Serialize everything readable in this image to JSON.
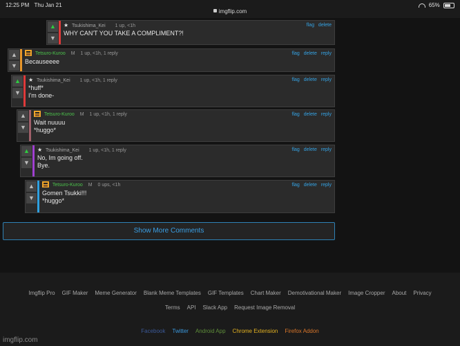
{
  "status_bar": {
    "time": "12:25 PM",
    "date": "Thu Jan 21",
    "url": "imgflip.com",
    "battery": "65%",
    "battery_level": 0.65
  },
  "comments": [
    {
      "user": "Tsukishima_Kei",
      "mod": "",
      "stats": "1 up, <1h",
      "actions": [
        "flag",
        "delete"
      ],
      "lines": "WHY CAN'T YOU TAKE A COMPLIMENT?!",
      "accent": "#e03a3a",
      "upvoted": true,
      "avatar": "star-icon",
      "name_color": "gray"
    },
    {
      "user": "Tetsuro-Kuroo",
      "mod": "M",
      "stats": "1 up, <1h, 1 reply",
      "actions": [
        "flag",
        "delete",
        "reply"
      ],
      "lines": "Becauseeee",
      "accent": "#e8962a",
      "upvoted": false,
      "avatar": "avatar-icon",
      "name_color": "green"
    },
    {
      "user": "Tsukishima_Kei",
      "mod": "",
      "stats": "1 up, <1h, 1 reply",
      "actions": [
        "flag",
        "delete",
        "reply"
      ],
      "lines": "*huff*\nI'm done-",
      "accent": "#e03a3a",
      "upvoted": true,
      "avatar": "star-icon",
      "name_color": "gray"
    },
    {
      "user": "Tetsuro-Kuroo",
      "mod": "M",
      "stats": "1 up, <1h, 1 reply",
      "actions": [
        "flag",
        "delete",
        "reply"
      ],
      "lines": "Wait nuuuu\n*huggo*",
      "accent": "#a0606a",
      "upvoted": false,
      "avatar": "avatar-icon",
      "name_color": "green"
    },
    {
      "user": "Tsukishima_Kei",
      "mod": "",
      "stats": "1 up, <1h, 1 reply",
      "actions": [
        "flag",
        "delete",
        "reply"
      ],
      "lines": "No, Im going off.\nBye.",
      "accent": "#a040d0",
      "upvoted": true,
      "avatar": "star-icon",
      "name_color": "gray"
    },
    {
      "user": "Tetsuro-Kuroo",
      "mod": "M",
      "stats": "0 ups, <1h",
      "actions": [
        "flag",
        "delete",
        "reply"
      ],
      "lines": "Gomen Tsukki!!!\n*huggo*",
      "accent": "#2ea0e0",
      "upvoted": false,
      "avatar": "avatar-icon",
      "name_color": "green"
    }
  ],
  "show_more_label": "Show More Comments",
  "footer": {
    "row1": [
      "Imgflip Pro",
      "GIF Maker",
      "Meme Generator",
      "Blank Meme Templates",
      "GIF Templates",
      "Chart Maker",
      "Demotivational Maker",
      "Image Cropper",
      "About",
      "Privacy"
    ],
    "row2": [
      "Terms",
      "API",
      "Slack App",
      "Request Image Removal"
    ],
    "row3": [
      {
        "label": "Facebook",
        "color": "#3b5998"
      },
      {
        "label": "Twitter",
        "color": "#3a9ae0"
      },
      {
        "label": "Android App",
        "color": "#5f8f3a"
      },
      {
        "label": "Chrome Extension",
        "color": "#e6b422"
      },
      {
        "label": "Firefox Addon",
        "color": "#d9762a"
      }
    ]
  },
  "brand": "imgflip.com"
}
